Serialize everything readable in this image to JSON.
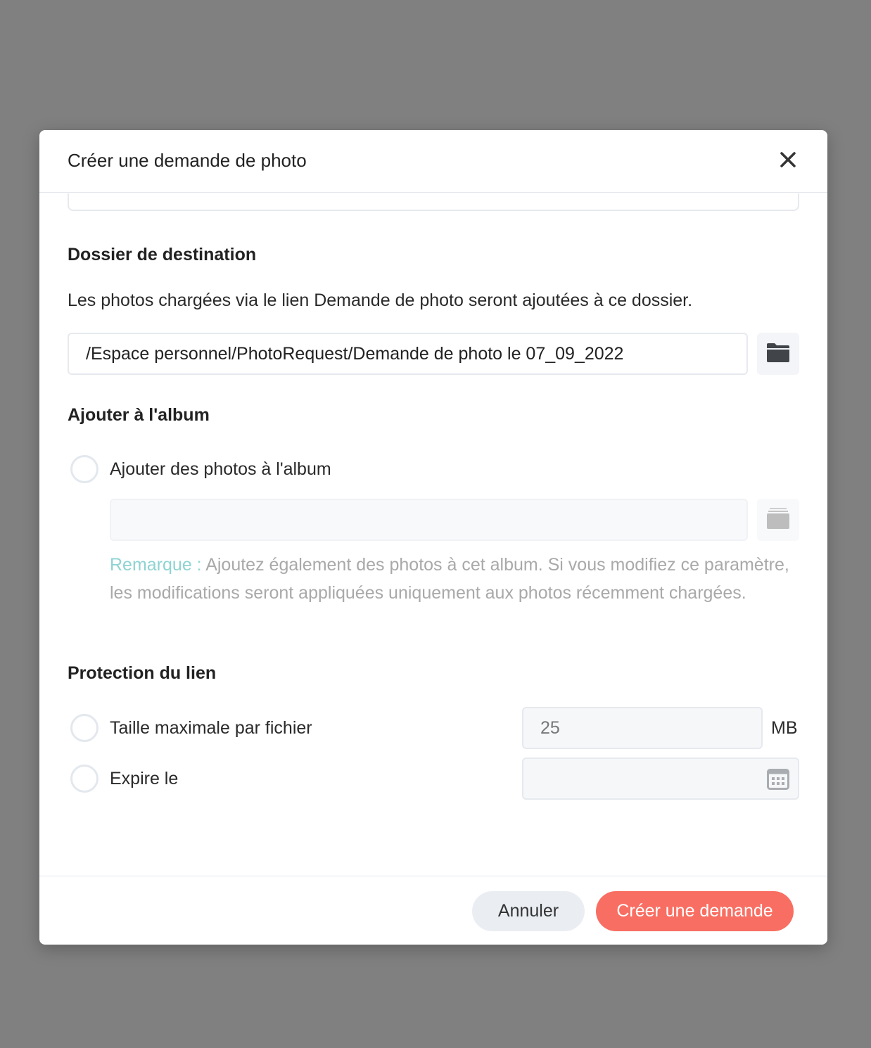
{
  "dialog": {
    "title": "Créer une demande de photo"
  },
  "destination": {
    "title": "Dossier de destination",
    "description": "Les photos chargées via le lien Demande de photo seront ajoutées à ce dossier.",
    "path_value": "/Espace personnel/PhotoRequest/Demande de photo le 07_09_2022"
  },
  "album": {
    "title": "Ajouter à l'album",
    "option_label": "Ajouter des photos à l'album",
    "input_value": "",
    "note_label": "Remarque :",
    "note_text": "Ajoutez également des photos à cet album. Si vous modifiez ce paramètre, les modifications seront appliquées uniquement aux photos récemment chargées."
  },
  "protection": {
    "title": "Protection du lien",
    "max_size_label": "Taille maximale par fichier",
    "max_size_value": "25",
    "max_size_unit": "MB",
    "expire_label": "Expire le",
    "expire_value": ""
  },
  "footer": {
    "cancel_label": "Annuler",
    "create_label": "Créer une demande"
  },
  "colors": {
    "primary": "#f86e62",
    "note_accent": "#8fd3d3",
    "overlay": "#808080"
  },
  "icons": [
    "close-icon",
    "folder-icon",
    "album-icon",
    "calendar-icon"
  ]
}
